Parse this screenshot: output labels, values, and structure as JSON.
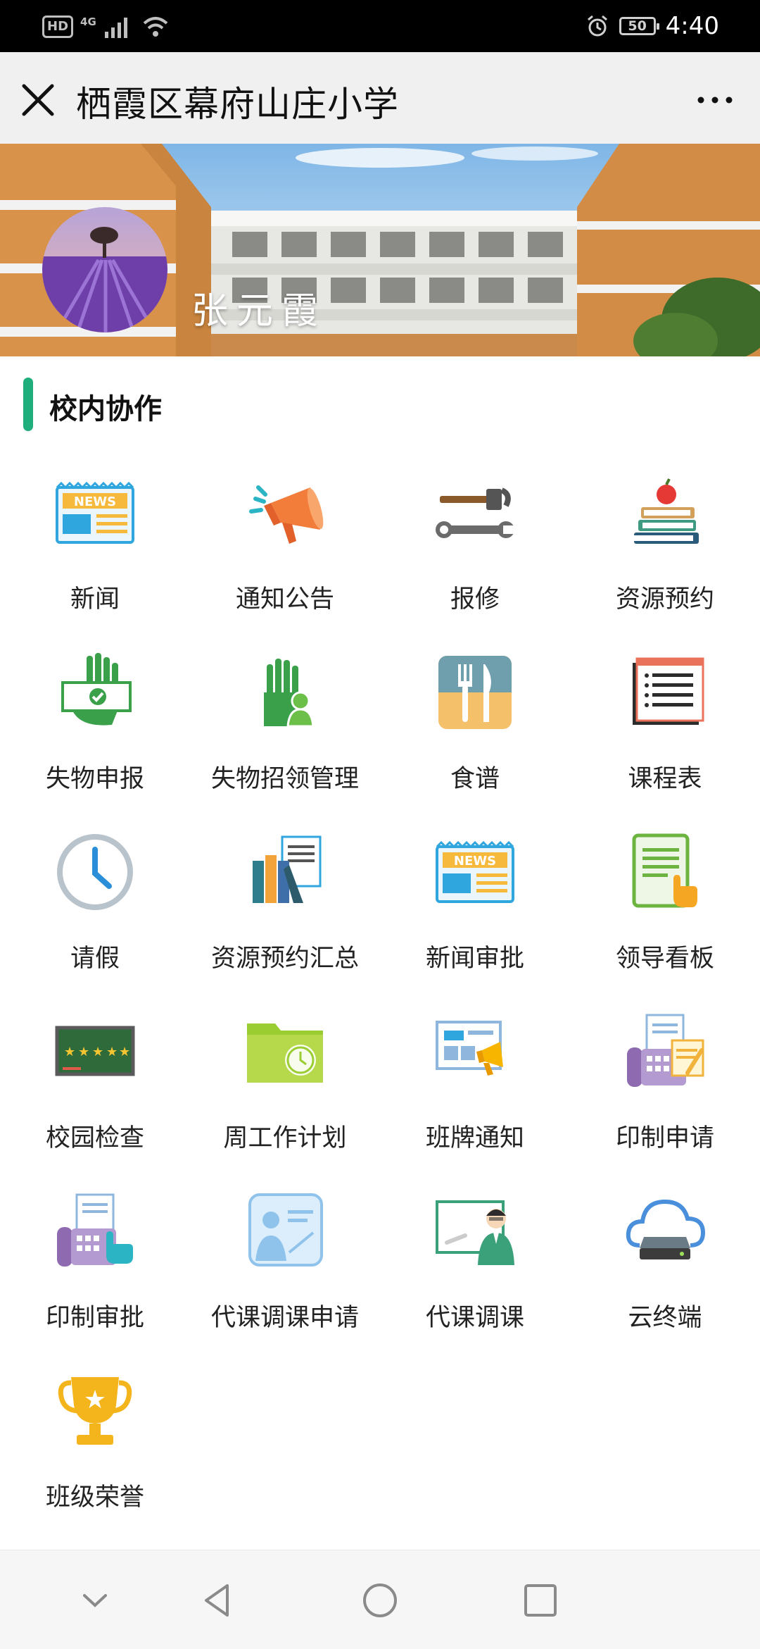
{
  "status_bar": {
    "hd": "HD",
    "network": "4G",
    "battery": "50",
    "time": "4:40"
  },
  "header": {
    "title": "栖霞区幕府山庄小学"
  },
  "banner": {
    "username": "张元霞"
  },
  "section": {
    "title": "校内协作",
    "accent_color": "#1fae7c"
  },
  "apps": [
    {
      "label": "新闻",
      "icon": "news-icon"
    },
    {
      "label": "通知公告",
      "icon": "megaphone-icon"
    },
    {
      "label": "报修",
      "icon": "repair-tools-icon"
    },
    {
      "label": "资源预约",
      "icon": "books-apple-icon"
    },
    {
      "label": "失物申报",
      "icon": "hand-check-icon"
    },
    {
      "label": "失物招领管理",
      "icon": "hand-person-icon"
    },
    {
      "label": "食谱",
      "icon": "fork-knife-icon"
    },
    {
      "label": "课程表",
      "icon": "schedule-list-icon"
    },
    {
      "label": "请假",
      "icon": "clock-icon"
    },
    {
      "label": "资源预约汇总",
      "icon": "binders-document-icon"
    },
    {
      "label": "新闻审批",
      "icon": "news-icon"
    },
    {
      "label": "领导看板",
      "icon": "tablet-touch-icon"
    },
    {
      "label": "校园检查",
      "icon": "star-board-icon"
    },
    {
      "label": "周工作计划",
      "icon": "folder-clock-icon"
    },
    {
      "label": "班牌通知",
      "icon": "display-megaphone-icon"
    },
    {
      "label": "印制申请",
      "icon": "fax-document-icon"
    },
    {
      "label": "印制审批",
      "icon": "fax-touch-icon"
    },
    {
      "label": "代课调课申请",
      "icon": "person-card-icon"
    },
    {
      "label": "代课调课",
      "icon": "teacher-board-icon"
    },
    {
      "label": "云终端",
      "icon": "cloud-drive-icon"
    },
    {
      "label": "班级荣誉",
      "icon": "trophy-icon"
    }
  ],
  "nav": {
    "buttons": [
      "down-chevron-icon",
      "back-triangle-icon",
      "home-circle-icon",
      "recents-square-icon"
    ]
  }
}
